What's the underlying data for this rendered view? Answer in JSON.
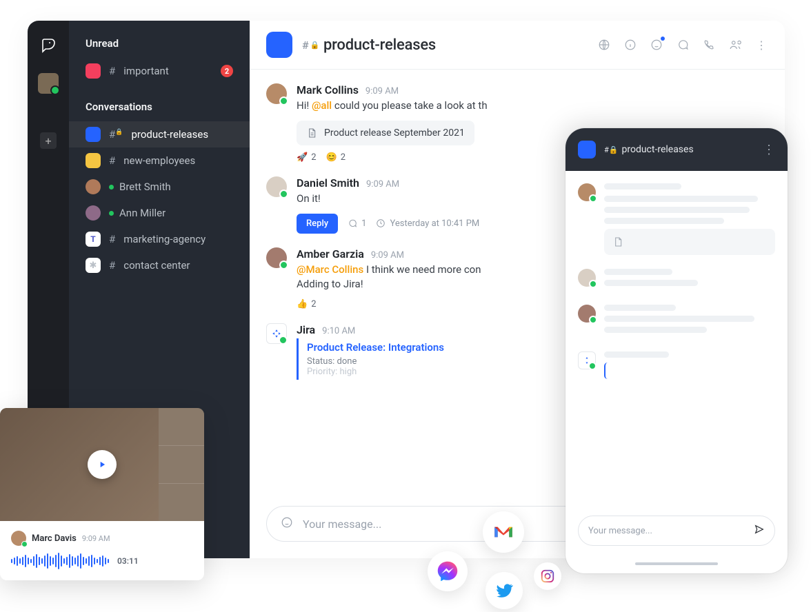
{
  "sidebar": {
    "unread_title": "Unread",
    "conversations_title": "Conversations",
    "items": {
      "important": {
        "label": "important",
        "badge": "2"
      },
      "product_releases": {
        "label": "product-releases"
      },
      "new_employees": {
        "label": "new-employees"
      },
      "brett": {
        "label": "Brett Smith"
      },
      "ann": {
        "label": "Ann Miller"
      },
      "marketing": {
        "label": "marketing-agency"
      },
      "contact_center": {
        "label": "contact center"
      }
    }
  },
  "header": {
    "channel": "product-releases"
  },
  "messages": {
    "mark": {
      "name": "Mark Collins",
      "time": "9:09 AM",
      "text_prefix": "Hi! ",
      "mention": "@all",
      "text_suffix": " could you please take a look at th",
      "attachment": "Product release September 2021",
      "react_rocket": "2",
      "react_smile": "2"
    },
    "daniel": {
      "name": "Daniel Smith",
      "time": "9:09 AM",
      "text": "On it!",
      "reply_label": "Reply",
      "thread_count": "1",
      "thread_time": "Yesterday at 10:41 PM"
    },
    "amber": {
      "name": "Amber Garzia",
      "time": "9:09 AM",
      "mention": "@Marc Collins",
      "text": " I think we need more con",
      "text2": "Adding to Jira!",
      "react_thumb": "2"
    },
    "jira": {
      "name": "Jira",
      "time": "9:10 AM",
      "card_title": "Product Release: Integrations",
      "status": "Status: done",
      "priority": "Priority: high"
    }
  },
  "composer": {
    "placeholder": "Your message..."
  },
  "mobile": {
    "channel": "product-releases",
    "placeholder": "Your message..."
  },
  "voice": {
    "name": "Marc Davis",
    "time": "9:09 AM",
    "duration": "03:11"
  }
}
